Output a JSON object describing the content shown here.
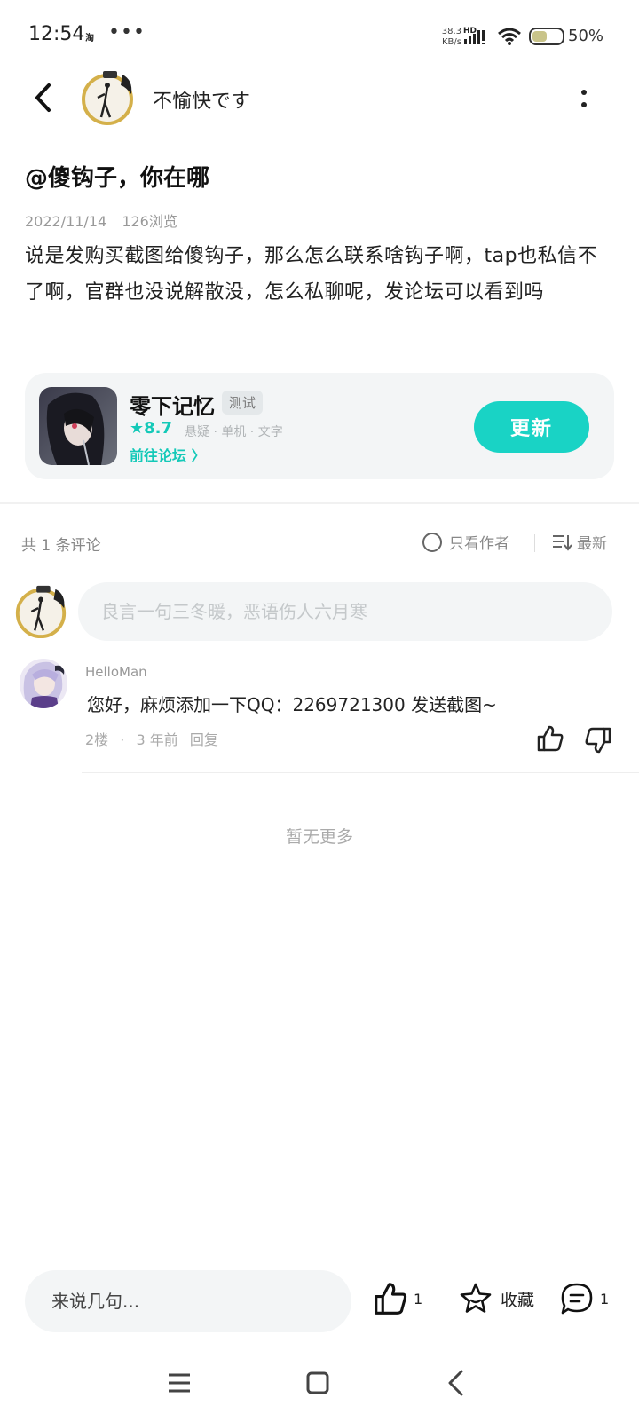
{
  "status_bar": {
    "time": "12:54",
    "taobao_icon": "淘",
    "more_dots": "•••",
    "net_speed_value": "38.3",
    "net_speed_unit": "KB/s",
    "signal_label": "HD",
    "battery_text": "50%",
    "battery_level": 0.5
  },
  "header": {
    "author_name": "不愉快です",
    "back_icon": "chevron-left-icon",
    "more_icon": "vertical-dots-icon"
  },
  "post": {
    "title": "@傻钩子，你在哪",
    "date": "2022/11/14",
    "views": "126浏览",
    "body": "说是发购买截图给傻钩子，那么怎么联系啥钩子啊，tap也私信不了啊，官群也没说解散没，怎么私聊呢，发论坛可以看到吗"
  },
  "game_card": {
    "name": "零下记忆",
    "tag": "测试",
    "score": "★8.7",
    "categories": "悬疑 · 单机 · 文字",
    "forum_link": "前往论坛 〉",
    "update_button": "更新"
  },
  "comments_bar": {
    "count": "共 1 条评论",
    "only_author": "只看作者",
    "sort": "最新"
  },
  "comment_input": {
    "placeholder": "良言一句三冬暖，恶语伤人六月寒"
  },
  "comments": [
    {
      "user": "HelloMan",
      "text": "您好，麻烦添加一下QQ：2269721300 发送截图~",
      "floor": "2楼",
      "sep": "·",
      "time": "3 年前",
      "reply": "回复"
    }
  ],
  "no_more": "暂无更多",
  "bottom_bar": {
    "input_placeholder": "来说几句...",
    "like_count": "1",
    "favorite_label": "收藏",
    "comment_count": "1"
  },
  "colors": {
    "accent": "#19d3c5",
    "score": "#14c9b8",
    "card_bg": "#f3f5f6"
  }
}
